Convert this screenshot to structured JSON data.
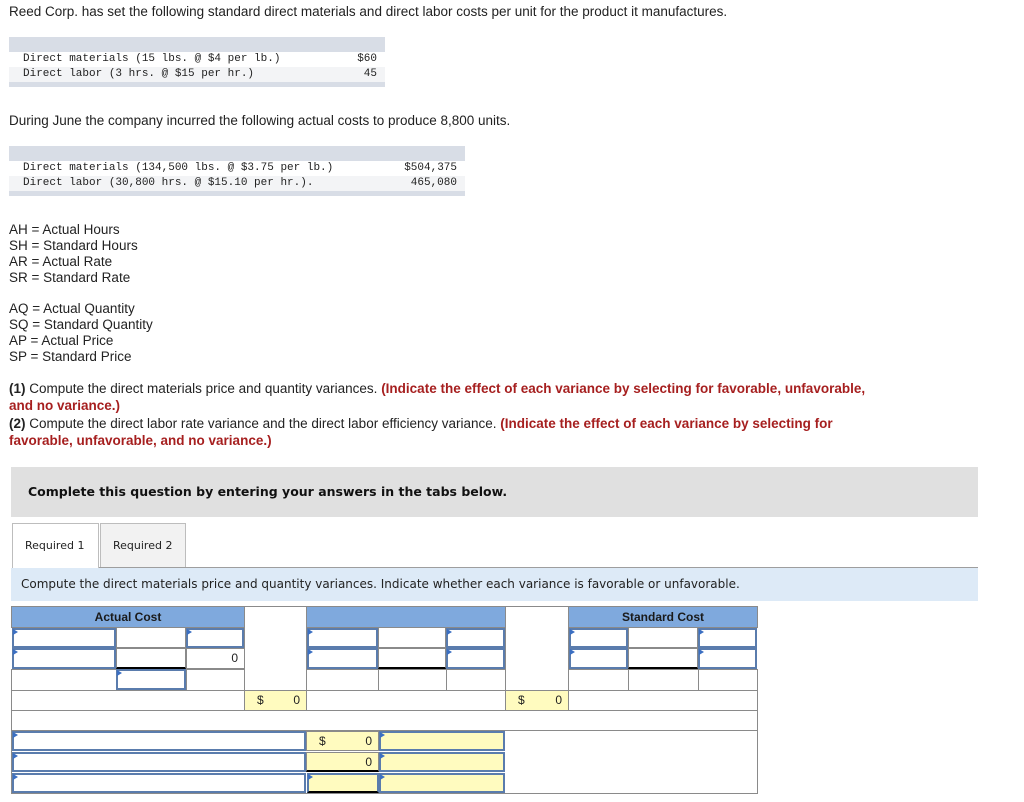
{
  "intro_text": "Reed Corp. has set the following standard direct materials and direct labor costs per unit for the product it manufactures.",
  "standards_table": [
    {
      "label": "Direct materials (15 lbs. @ $4 per lb.)",
      "value": "$60"
    },
    {
      "label": "Direct labor (3 hrs. @ $15 per hr.)",
      "value": "45"
    }
  ],
  "during_text": "During June the company incurred the following actual costs to produce 8,800 units.",
  "actual_table": [
    {
      "label": "Direct materials (134,500 lbs. @ $3.75 per lb.)",
      "value": "$504,375"
    },
    {
      "label": "Direct labor (30,800 hrs. @ $15.10 per hr.).",
      "value": "465,080"
    }
  ],
  "definitions_labor": [
    "AH = Actual Hours",
    "SH = Standard Hours",
    "AR = Actual Rate",
    "SR = Standard Rate"
  ],
  "definitions_materials": [
    "AQ = Actual Quantity",
    "SQ = Standard Quantity",
    "AP = Actual Price",
    "SP = Standard Price"
  ],
  "questions": [
    {
      "num": "(1)",
      "text": " Compute the direct materials price and quantity variances. ",
      "note": "(Indicate the effect of each variance by selecting for favorable, unfavorable, and no variance.)"
    },
    {
      "num": "(2)",
      "text": " Compute the direct labor rate variance and the direct labor efficiency variance. ",
      "note": "(Indicate the effect of each variance by selecting for favorable, unfavorable, and no variance.)"
    }
  ],
  "complete_bar": "Complete this question by entering your answers in the tabs below.",
  "tabs": [
    {
      "label": "Required 1",
      "active": true
    },
    {
      "label": "Required 2",
      "active": false
    }
  ],
  "instruction": "Compute the direct materials price and quantity variances. Indicate whether each variance is favorable or unfavorable.",
  "worksheet": {
    "actual_cost_header": "Actual Cost",
    "middle_header": "",
    "standard_cost_header": "Standard Cost",
    "actual_total_value": "0",
    "actual_sum": {
      "currency": "$",
      "value": "0"
    },
    "standard_sum": {
      "currency": "$",
      "value": "0"
    },
    "variance_rows": [
      {
        "currency": "$",
        "value": "0"
      },
      {
        "currency": "",
        "value": "0"
      },
      {
        "currency": "",
        "value": ""
      }
    ]
  }
}
